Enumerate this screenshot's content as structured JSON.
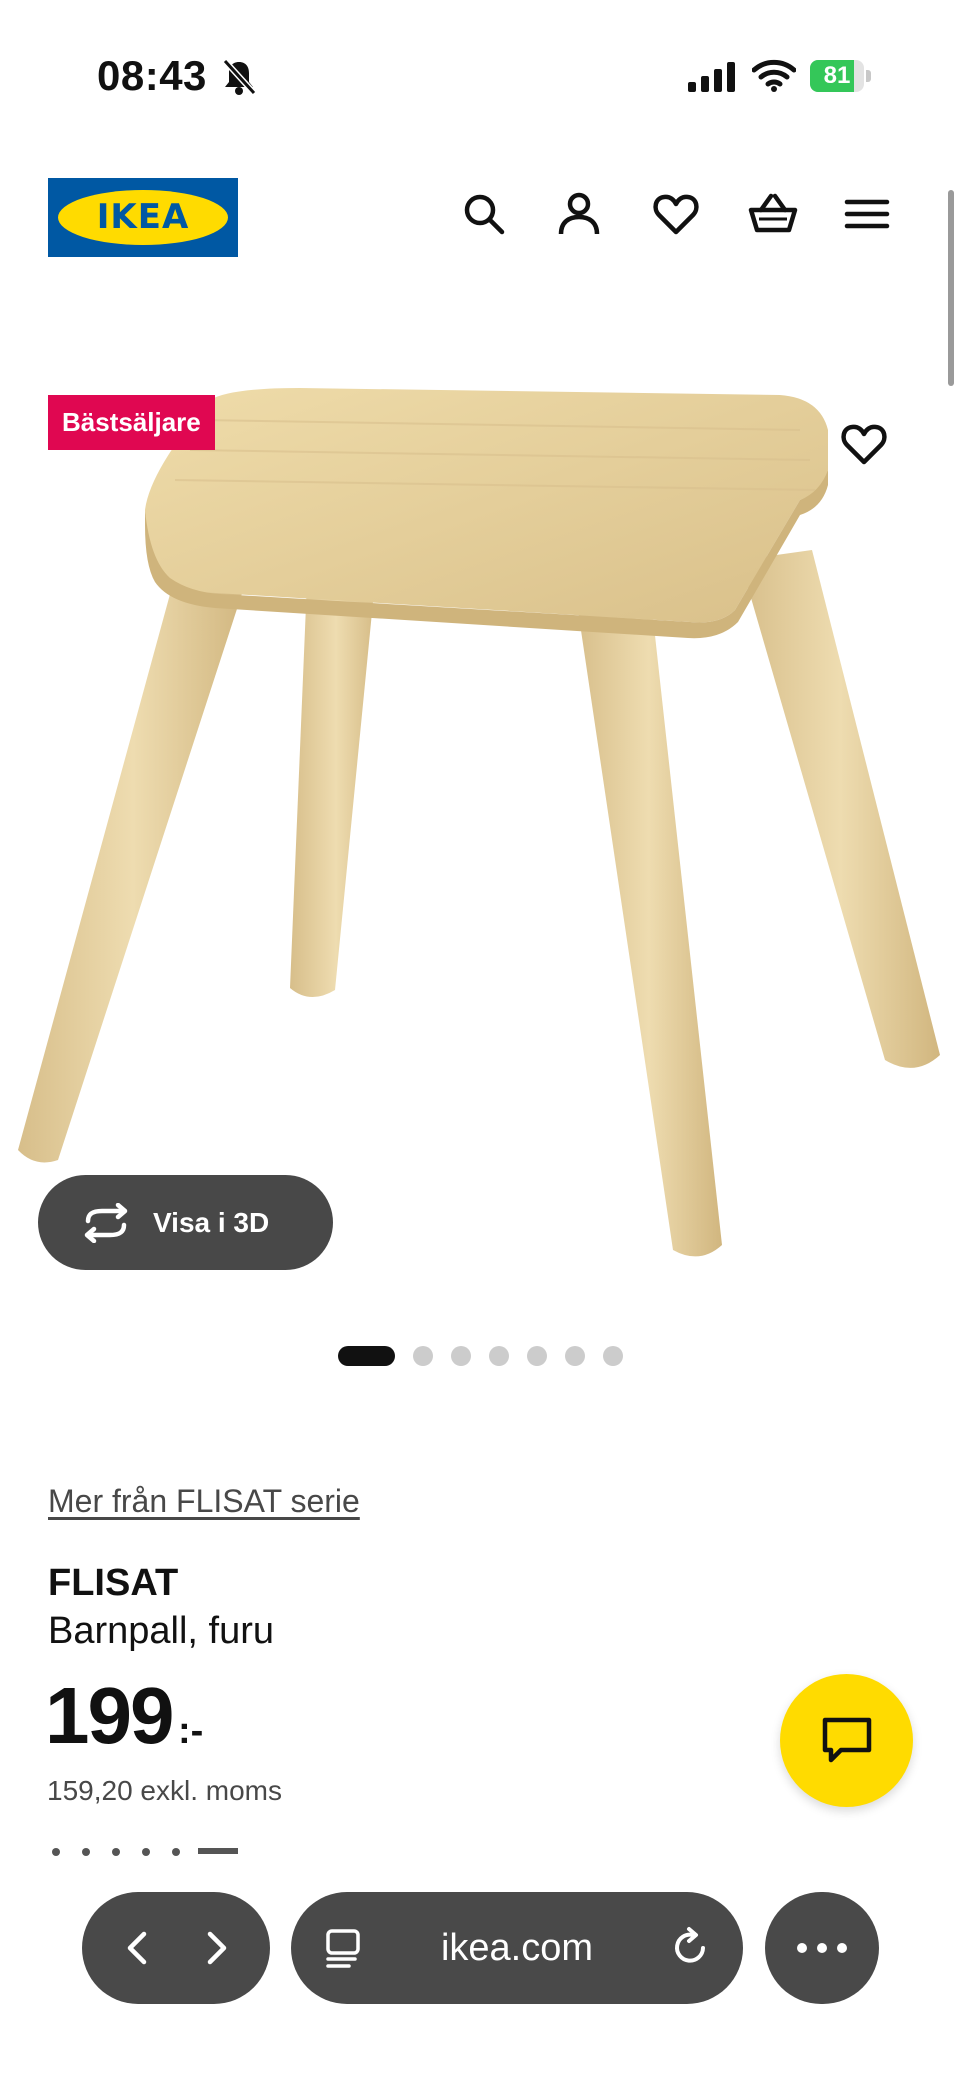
{
  "status_bar": {
    "time": "08:43",
    "battery_percent": "81",
    "battery_level": 0.81,
    "icons": [
      "bell-slash-icon",
      "cellular-signal-icon",
      "wifi-icon",
      "battery-charging-icon"
    ]
  },
  "header": {
    "logo_text": "IKEA",
    "icons": [
      "search-icon",
      "account-icon",
      "favourites-icon",
      "shopping-basket-icon",
      "menu-icon"
    ]
  },
  "product_image": {
    "badge": "Bästsäljare",
    "view_3d_label": "Visa i 3D",
    "carousel_total": 7,
    "carousel_active": 1
  },
  "product": {
    "series_link": "Mer från FLISAT serie",
    "name": "FLISAT",
    "description": "Barnpall, furu",
    "price": "199",
    "price_suffix": ":-",
    "price_excl_vat": "159,20 exkl. moms"
  },
  "browser": {
    "url": "ikea.com"
  },
  "colors": {
    "ikea_blue": "#0058a3",
    "ikea_yellow": "#ffdb00",
    "badge_red": "#e00751",
    "pill_gray": "#494949",
    "battery_green": "#34c759"
  }
}
